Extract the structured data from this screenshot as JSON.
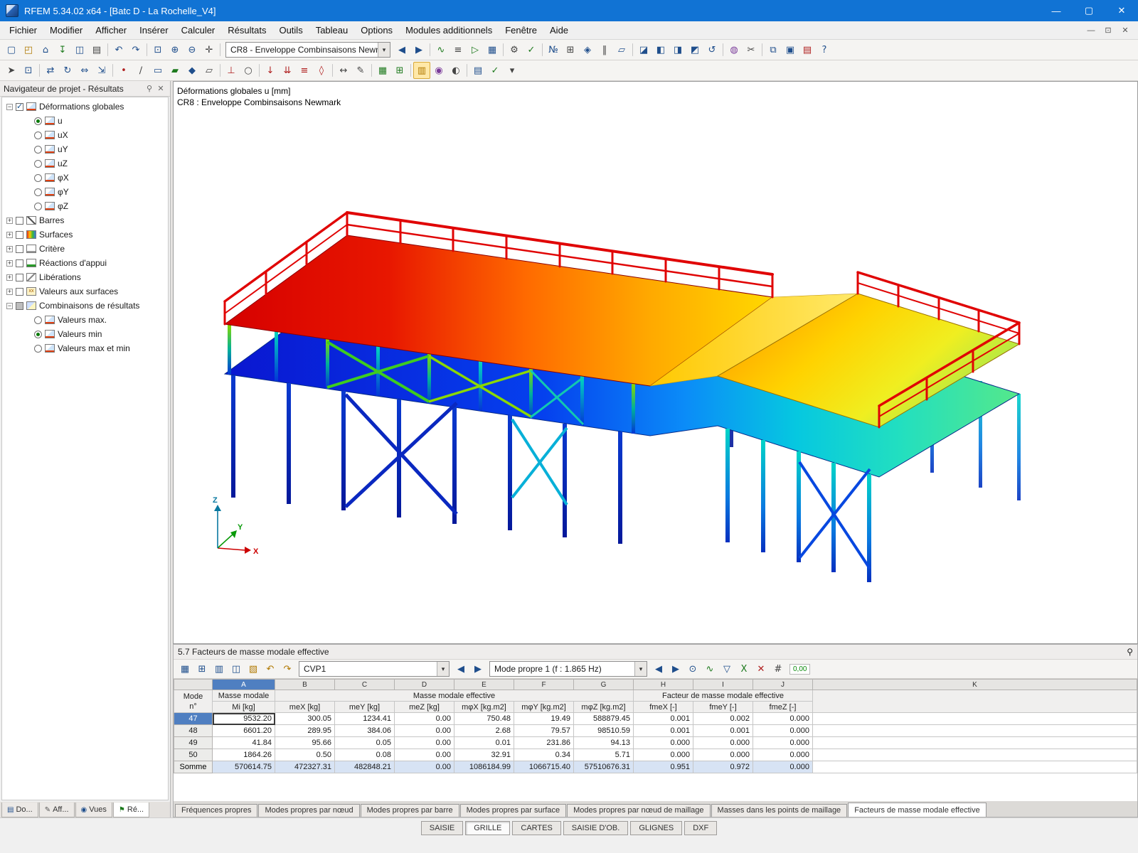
{
  "colors": {
    "titlebar": "#1173d4",
    "selection": "#4f7fc1",
    "railing": "#e00404",
    "deck_hot": "#ff7700",
    "deck_cold": "#0a16d0"
  },
  "window": {
    "title": "RFEM 5.34.02 x64 - [Batc D - La Rochelle_V4]",
    "buttons": [
      {
        "name": "minimize-button",
        "glyph": "—"
      },
      {
        "name": "maximize-button",
        "glyph": "▢"
      },
      {
        "name": "close-button",
        "glyph": "✕"
      }
    ]
  },
  "menubar": {
    "items": [
      {
        "name": "menu-fichier",
        "label": "Fichier"
      },
      {
        "name": "menu-modifier",
        "label": "Modifier"
      },
      {
        "name": "menu-afficher",
        "label": "Afficher"
      },
      {
        "name": "menu-inserer",
        "label": "Insérer"
      },
      {
        "name": "menu-calculer",
        "label": "Calculer"
      },
      {
        "name": "menu-resultats",
        "label": "Résultats"
      },
      {
        "name": "menu-outils",
        "label": "Outils"
      },
      {
        "name": "menu-tableau",
        "label": "Tableau"
      },
      {
        "name": "menu-options",
        "label": "Options"
      },
      {
        "name": "menu-modules-additionnels",
        "label": "Modules additionnels"
      },
      {
        "name": "menu-fenetre",
        "label": "Fenêtre"
      },
      {
        "name": "menu-aide",
        "label": "Aide"
      }
    ],
    "mdi": [
      {
        "name": "mdi-minimize-button",
        "glyph": "—"
      },
      {
        "name": "mdi-restore-button",
        "glyph": "⊡"
      },
      {
        "name": "mdi-close-button",
        "glyph": "✕"
      }
    ]
  },
  "ui": {
    "dropdown_glyph": "▾",
    "prev_glyph": "◀",
    "next_glyph": "▶"
  },
  "toolbar1": {
    "a": [
      {
        "name": "new-file-icon",
        "glyph": "▢",
        "c": "b"
      },
      {
        "name": "open-icon",
        "glyph": "◰",
        "c": "y"
      },
      {
        "name": "project-manager-icon",
        "glyph": "⌂",
        "c": "b"
      },
      {
        "name": "import-icon",
        "glyph": "↧",
        "c": "g"
      },
      {
        "name": "save-icon",
        "glyph": "◫",
        "c": "b"
      },
      {
        "name": "print-icon",
        "glyph": "▤",
        "c": "k"
      },
      {
        "name": "separator",
        "glyph": "",
        "kind": "s",
        "interactable": false
      },
      {
        "name": "undo-icon",
        "glyph": "↶",
        "c": "b"
      },
      {
        "name": "redo-icon",
        "glyph": "↷",
        "c": "b"
      },
      {
        "name": "separator",
        "glyph": "",
        "kind": "s",
        "interactable": false
      },
      {
        "name": "zoom-window-icon",
        "glyph": "⊡",
        "c": "b"
      },
      {
        "name": "zoom-in-icon",
        "glyph": "⊕",
        "c": "b"
      },
      {
        "name": "zoom-out-icon",
        "glyph": "⊖",
        "c": "b"
      },
      {
        "name": "pan-icon",
        "glyph": "✛",
        "c": "k"
      },
      {
        "name": "separator",
        "glyph": "",
        "kind": "s",
        "interactable": false
      }
    ],
    "combo": "CR8 - Enveloppe Combinsaisons Newn",
    "b": [
      {
        "name": "previous-loadcase-icon",
        "glyph": "◀",
        "c": "b"
      },
      {
        "name": "next-loadcase-icon",
        "glyph": "▶",
        "c": "b"
      },
      {
        "name": "separator",
        "glyph": "",
        "kind": "s",
        "interactable": false
      },
      {
        "name": "show-results-icon",
        "glyph": "∿",
        "c": "g"
      },
      {
        "name": "result-values-icon",
        "glyph": "≡",
        "c": "k"
      },
      {
        "name": "animation-icon",
        "glyph": "▷",
        "c": "g"
      },
      {
        "name": "result-panel-icon",
        "glyph": "▦",
        "c": "b"
      },
      {
        "name": "separator",
        "glyph": "",
        "kind": "s",
        "interactable": false
      },
      {
        "name": "calculate-icon",
        "glyph": "⚙",
        "c": "k"
      },
      {
        "name": "check-model-icon",
        "glyph": "✓",
        "c": "g"
      },
      {
        "name": "separator",
        "glyph": "",
        "kind": "s",
        "interactable": false
      },
      {
        "name": "numbering-icon",
        "glyph": "№",
        "c": "b"
      },
      {
        "name": "grid-icon",
        "glyph": "⊞",
        "c": "k"
      },
      {
        "name": "snap-icon",
        "glyph": "◈",
        "c": "b"
      },
      {
        "name": "guidelines-icon",
        "glyph": "‖",
        "c": "k"
      },
      {
        "name": "workplane-icon",
        "glyph": "▱",
        "c": "b"
      },
      {
        "name": "separator",
        "glyph": "",
        "kind": "s",
        "interactable": false
      },
      {
        "name": "isometric-view-icon",
        "glyph": "◪",
        "c": "b"
      },
      {
        "name": "view-x-icon",
        "glyph": "◧",
        "c": "b"
      },
      {
        "name": "view-y-icon",
        "glyph": "◨",
        "c": "b"
      },
      {
        "name": "view-z-icon",
        "glyph": "◩",
        "c": "b"
      },
      {
        "name": "previous-view-icon",
        "glyph": "↺",
        "c": "b"
      },
      {
        "name": "separator",
        "glyph": "",
        "kind": "s",
        "interactable": false
      },
      {
        "name": "visibility-filter-icon",
        "glyph": "◍",
        "c": "m"
      },
      {
        "name": "clipping-plane-icon",
        "glyph": "✂",
        "c": "k"
      },
      {
        "name": "separator",
        "glyph": "",
        "kind": "s",
        "interactable": false
      },
      {
        "name": "new-window-icon",
        "glyph": "⧉",
        "c": "b"
      },
      {
        "name": "arrange-windows-icon",
        "glyph": "▣",
        "c": "b"
      },
      {
        "name": "print-graphic-icon",
        "glyph": "▤",
        "c": "r"
      },
      {
        "name": "help-icon",
        "glyph": "?",
        "c": "b"
      }
    ]
  },
  "toolbar2": {
    "items": [
      {
        "name": "select-icon",
        "glyph": "➤",
        "c": "k"
      },
      {
        "name": "select-window-icon",
        "glyph": "⊡",
        "c": "b"
      },
      {
        "name": "separator",
        "glyph": "",
        "kind": "s",
        "interactable": false
      },
      {
        "name": "move-icon",
        "glyph": "⇄",
        "c": "b"
      },
      {
        "name": "rotate-icon",
        "glyph": "↻",
        "c": "b"
      },
      {
        "name": "mirror-icon",
        "glyph": "⇔",
        "c": "b"
      },
      {
        "name": "scale-icon",
        "glyph": "⇲",
        "c": "b"
      },
      {
        "name": "separator",
        "glyph": "",
        "kind": "s",
        "interactable": false
      },
      {
        "name": "node-icon",
        "glyph": "•",
        "c": "r"
      },
      {
        "name": "line-icon",
        "glyph": "∕",
        "c": "k"
      },
      {
        "name": "member-icon",
        "glyph": "▭",
        "c": "b"
      },
      {
        "name": "surface-icon",
        "glyph": "▰",
        "c": "g"
      },
      {
        "name": "solid-icon",
        "glyph": "◆",
        "c": "b"
      },
      {
        "name": "opening-icon",
        "glyph": "▱",
        "c": "k"
      },
      {
        "name": "separator",
        "glyph": "",
        "kind": "s",
        "interactable": false
      },
      {
        "name": "support-icon",
        "glyph": "⊥",
        "c": "r"
      },
      {
        "name": "hinge-icon",
        "glyph": "○",
        "c": "k"
      },
      {
        "name": "separator",
        "glyph": "",
        "kind": "s",
        "interactable": false
      },
      {
        "name": "nodal-load-icon",
        "glyph": "↓",
        "c": "r"
      },
      {
        "name": "member-load-icon",
        "glyph": "⇊",
        "c": "r"
      },
      {
        "name": "surface-load-icon",
        "glyph": "≡",
        "c": "r"
      },
      {
        "name": "free-load-icon",
        "glyph": "◊",
        "c": "r"
      },
      {
        "name": "separator",
        "glyph": "",
        "kind": "s",
        "interactable": false
      },
      {
        "name": "dimension-icon",
        "glyph": "↔",
        "c": "k"
      },
      {
        "name": "comment-icon",
        "glyph": "✎",
        "c": "k"
      },
      {
        "name": "separator",
        "glyph": "",
        "kind": "s",
        "interactable": false
      },
      {
        "name": "mesh-icon",
        "glyph": "▦",
        "c": "g"
      },
      {
        "name": "mesh-refinement-icon",
        "glyph": "⊞",
        "c": "g"
      },
      {
        "name": "separator",
        "glyph": "",
        "kind": "s",
        "interactable": false
      },
      {
        "name": "panel-toggle-icon",
        "glyph": "▥",
        "c": "y",
        "active": true
      },
      {
        "name": "display-properties-icon",
        "glyph": "◉",
        "c": "m"
      },
      {
        "name": "render-mode-icon",
        "glyph": "◐",
        "c": "k"
      },
      {
        "name": "separator",
        "glyph": "",
        "kind": "s",
        "interactable": false
      },
      {
        "name": "tables-toggle-icon",
        "glyph": "▤",
        "c": "b"
      },
      {
        "name": "model-check-icon",
        "glyph": "✓",
        "c": "g"
      },
      {
        "name": "chevron-down-icon",
        "glyph": "▾",
        "c": "k"
      }
    ]
  },
  "navigator": {
    "title": "Navigateur de projet - Résultats",
    "pin_glyph": "⚲",
    "close_glyph": "✕",
    "tree": [
      {
        "name": "tree-item-deformations-globales",
        "label": "Déformations globales",
        "level": 0,
        "exp": "minus",
        "check": "checked",
        "icon": "deform"
      },
      {
        "name": "tree-item-u",
        "label": "u",
        "level": 1,
        "exp": "none",
        "check": "radio-on",
        "icon": "deform"
      },
      {
        "name": "tree-item-ux",
        "label": "uX",
        "level": 1,
        "exp": "none",
        "check": "radio-off",
        "icon": "deform"
      },
      {
        "name": "tree-item-uy",
        "label": "uY",
        "level": 1,
        "exp": "none",
        "check": "radio-off",
        "icon": "deform"
      },
      {
        "name": "tree-item-uz",
        "label": "uZ",
        "level": 1,
        "exp": "none",
        "check": "radio-off",
        "icon": "deform"
      },
      {
        "name": "tree-item-phix",
        "label": "φX",
        "level": 1,
        "exp": "none",
        "check": "radio-off",
        "icon": "deform"
      },
      {
        "name": "tree-item-phiy",
        "label": "φY",
        "level": 1,
        "exp": "none",
        "check": "radio-off",
        "icon": "deform"
      },
      {
        "name": "tree-item-phiz",
        "label": "φZ",
        "level": 1,
        "exp": "none",
        "check": "radio-off",
        "icon": "deform"
      },
      {
        "name": "tree-item-barres",
        "label": "Barres",
        "level": 0,
        "exp": "plus",
        "check": "unchecked",
        "icon": "barres"
      },
      {
        "name": "tree-item-surfaces",
        "label": "Surfaces",
        "level": 0,
        "exp": "plus",
        "check": "unchecked",
        "icon": "surfaces"
      },
      {
        "name": "tree-item-critere",
        "label": "Critère",
        "level": 0,
        "exp": "plus",
        "check": "unchecked",
        "icon": "critere"
      },
      {
        "name": "tree-item-reactions-appui",
        "label": "Réactions d'appui",
        "level": 0,
        "exp": "plus",
        "check": "unchecked",
        "icon": "reactions"
      },
      {
        "name": "tree-item-liberations",
        "label": "Libérations",
        "level": 0,
        "exp": "plus",
        "check": "unchecked",
        "icon": "liberations"
      },
      {
        "name": "tree-item-valeurs-aux-surfaces",
        "label": "Valeurs aux surfaces",
        "level": 0,
        "exp": "plus",
        "check": "unchecked",
        "icon": "valeurs"
      },
      {
        "name": "tree-item-combinaisons-de-resultats",
        "label": "Combinaisons de résultats",
        "level": 0,
        "exp": "minus",
        "check": "partial",
        "icon": "combos"
      },
      {
        "name": "tree-item-valeurs-max",
        "label": "Valeurs max.",
        "level": 1,
        "exp": "none",
        "check": "radio-off",
        "icon": "deform"
      },
      {
        "name": "tree-item-valeurs-min",
        "label": "Valeurs min",
        "level": 1,
        "exp": "none",
        "check": "radio-on",
        "icon": "deform"
      },
      {
        "name": "tree-item-valeurs-max-et-min",
        "label": "Valeurs max et min",
        "level": 1,
        "exp": "none",
        "check": "radio-off",
        "icon": "deform"
      }
    ],
    "minitabs": [
      {
        "name": "nav-tab-donnees",
        "label": "Do...",
        "glyph": "▤",
        "c": "b",
        "active": false
      },
      {
        "name": "nav-tab-afficher",
        "label": "Aff...",
        "glyph": "✎",
        "c": "k",
        "active": false
      },
      {
        "name": "nav-tab-vues",
        "label": "Vues",
        "glyph": "◉",
        "c": "b",
        "active": false
      },
      {
        "name": "nav-tab-resultats",
        "label": "Ré...",
        "glyph": "⚑",
        "c": "g",
        "active": true
      }
    ]
  },
  "viewport": {
    "caption1": "Déformations globales u [mm]",
    "caption2": "CR8 : Enveloppe Combinsaisons Newmark",
    "axes": {
      "x": "X",
      "y": "Y",
      "z": "Z"
    }
  },
  "panel": {
    "title": "5.7 Facteurs de masse modale effective",
    "pin_glyph": "⚲",
    "toolbar_a": [
      {
        "name": "table-settings-icon",
        "glyph": "▦",
        "c": "b"
      },
      {
        "name": "insert-rows-icon",
        "glyph": "⊞",
        "c": "b"
      },
      {
        "name": "hide-columns-icon",
        "glyph": "▥",
        "c": "b"
      },
      {
        "name": "split-table-icon",
        "glyph": "◫",
        "c": "b"
      },
      {
        "name": "color-scale-icon",
        "glyph": "▧",
        "c": "y"
      },
      {
        "name": "table-undo-icon",
        "glyph": "↶",
        "c": "y"
      },
      {
        "name": "table-redo-icon",
        "glyph": "↷",
        "c": "y"
      }
    ],
    "combo1": "CVP1",
    "combo2": "Mode propre 1 (f : 1.865 Hz)",
    "toolbar_b": [
      {
        "name": "find-icon",
        "glyph": "⊙",
        "c": "b"
      },
      {
        "name": "chart-icon",
        "glyph": "∿",
        "c": "g"
      },
      {
        "name": "filter-icon",
        "glyph": "▽",
        "c": "b"
      },
      {
        "name": "excel-export-icon",
        "glyph": "X",
        "c": "g"
      },
      {
        "name": "delete-result-icon",
        "glyph": "✕",
        "c": "r"
      },
      {
        "name": "calculator-icon",
        "glyph": "#",
        "c": "k"
      }
    ],
    "decimals": "0,00"
  },
  "table": {
    "letters": [
      "A",
      "B",
      "C",
      "D",
      "E",
      "F",
      "G",
      "H",
      "I",
      "J",
      "K"
    ],
    "headers": {
      "stub": "Mode\nn°",
      "colA_top": "Masse modale",
      "colA_sub": "Mi [kg]",
      "group1": "Masse modale effective",
      "group2": "Facteur de masse modale effective",
      "sub": [
        "meX [kg]",
        "meY [kg]",
        "meZ [kg]",
        "mφX [kg.m2]",
        "mφY [kg.m2]",
        "mφZ [kg.m2]",
        "fmeX [-]",
        "fmeY [-]",
        "fmeZ [-]"
      ]
    },
    "rows": [
      {
        "mode": "47",
        "state": "selected",
        "cells": [
          "9532.20",
          "300.05",
          "1234.41",
          "0.00",
          "750.48",
          "19.49",
          "588879.45",
          "0.001",
          "0.002",
          "0.000",
          ""
        ]
      },
      {
        "mode": "48",
        "state": "",
        "cells": [
          "6601.20",
          "289.95",
          "384.06",
          "0.00",
          "2.68",
          "79.57",
          "98510.59",
          "0.001",
          "0.001",
          "0.000",
          ""
        ]
      },
      {
        "mode": "49",
        "state": "",
        "cells": [
          "41.84",
          "95.66",
          "0.05",
          "0.00",
          "0.01",
          "231.86",
          "94.13",
          "0.000",
          "0.000",
          "0.000",
          ""
        ]
      },
      {
        "mode": "50",
        "state": "",
        "cells": [
          "1864.26",
          "0.50",
          "0.08",
          "0.00",
          "32.91",
          "0.34",
          "5.71",
          "0.000",
          "0.000",
          "0.000",
          ""
        ]
      },
      {
        "mode": "Somme",
        "state": "sum",
        "cells": [
          "570614.75",
          "472327.31",
          "482848.21",
          "0.00",
          "1086184.99",
          "1066715.40",
          "57510676.31",
          "0.951",
          "0.972",
          "0.000",
          ""
        ]
      }
    ]
  },
  "sheet_tabs": [
    {
      "name": "tab-frequences-propres",
      "label": "Fréquences propres",
      "active": false
    },
    {
      "name": "tab-modes-propres-par-noeud",
      "label": "Modes propres par nœud",
      "active": false
    },
    {
      "name": "tab-modes-propres-par-barre",
      "label": "Modes propres par barre",
      "active": false
    },
    {
      "name": "tab-modes-propres-par-surface",
      "label": "Modes propres par surface",
      "active": false
    },
    {
      "name": "tab-modes-propres-par-noeud-de-maillage",
      "label": "Modes propres par nœud de maillage",
      "active": false
    },
    {
      "name": "tab-masses-dans-les-points-de-maillage",
      "label": "Masses dans les points de maillage",
      "active": false
    },
    {
      "name": "tab-facteurs-de-masse-modale-effective",
      "label": "Facteurs de masse modale effective",
      "active": true
    }
  ],
  "statusbar": {
    "buttons": [
      {
        "name": "status-saisie",
        "label": "SAISIE",
        "active": false
      },
      {
        "name": "status-grille",
        "label": "GRILLE",
        "active": true
      },
      {
        "name": "status-cartes",
        "label": "CARTES",
        "active": false
      },
      {
        "name": "status-saisie-dob",
        "label": "SAISIE D'OB.",
        "active": false
      },
      {
        "name": "status-glignes",
        "label": "GLIGNES",
        "active": false
      },
      {
        "name": "status-dxf",
        "label": "DXF",
        "active": false
      }
    ]
  }
}
